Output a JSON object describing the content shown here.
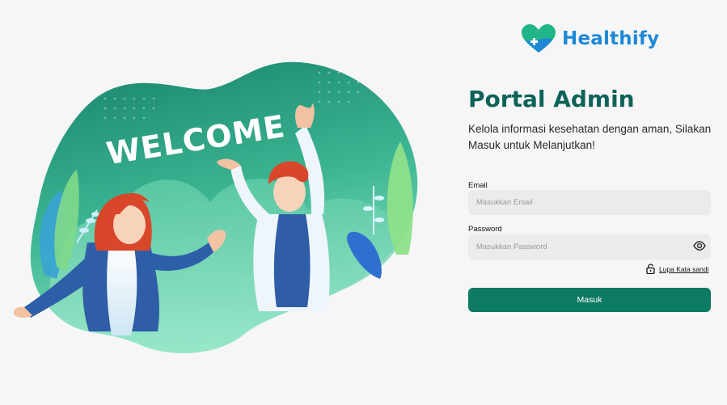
{
  "brand": {
    "name": "Healthify",
    "logo_icon": "heart-hands-logo"
  },
  "illustration": {
    "welcome_text": "WELCOME"
  },
  "login": {
    "title": "Portal Admin",
    "subtitle": "Kelola informasi kesehatan dengan aman, Silakan Masuk untuk Melanjutkan!",
    "email_label": "Email",
    "email_placeholder": "Masukkan Email",
    "email_value": "",
    "password_label": "Password",
    "password_placeholder": "Masukkan Password",
    "password_value": "",
    "password_toggle_icon": "eye-icon",
    "forgot_icon": "unlock-icon",
    "forgot_label": "Lupa Kata sandi",
    "submit_label": "Masuk"
  },
  "colors": {
    "primary": "#0d7a64",
    "title": "#0e6359",
    "brand_blue": "#1e88d6",
    "brand_green": "#22b58a",
    "blob_dark": "#1f8a73",
    "blob_light": "#7ed9b6"
  }
}
